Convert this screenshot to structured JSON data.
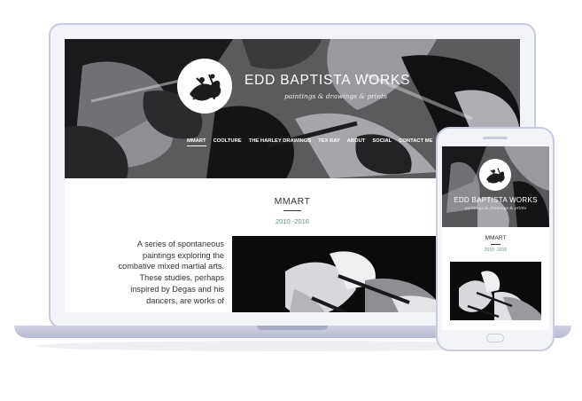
{
  "site": {
    "title": "EDD BAPTISTA WORKS",
    "tagline": "paintings & drawings & prints"
  },
  "nav": {
    "items": [
      {
        "label": "MMART",
        "active": true
      },
      {
        "label": "COOLTURE",
        "active": false
      },
      {
        "label": "THE HARLEY DRAWINGS",
        "active": false
      },
      {
        "label": "TEX RAY",
        "active": false
      },
      {
        "label": "ABOUT",
        "active": false
      },
      {
        "label": "SOCIAL",
        "active": false
      },
      {
        "label": "CONTACT ME",
        "active": false
      }
    ]
  },
  "page": {
    "title": "MMART",
    "years": "2010 -2016",
    "description": "A series of spontaneous paintings exploring the combative mixed martial arts. These studies, perhaps inspired by Degas and his dancers, are works of"
  },
  "colors": {
    "accent_teal": "#5a8e7a",
    "device_frame": "#c9cbdf",
    "text_dark": "#333333"
  }
}
